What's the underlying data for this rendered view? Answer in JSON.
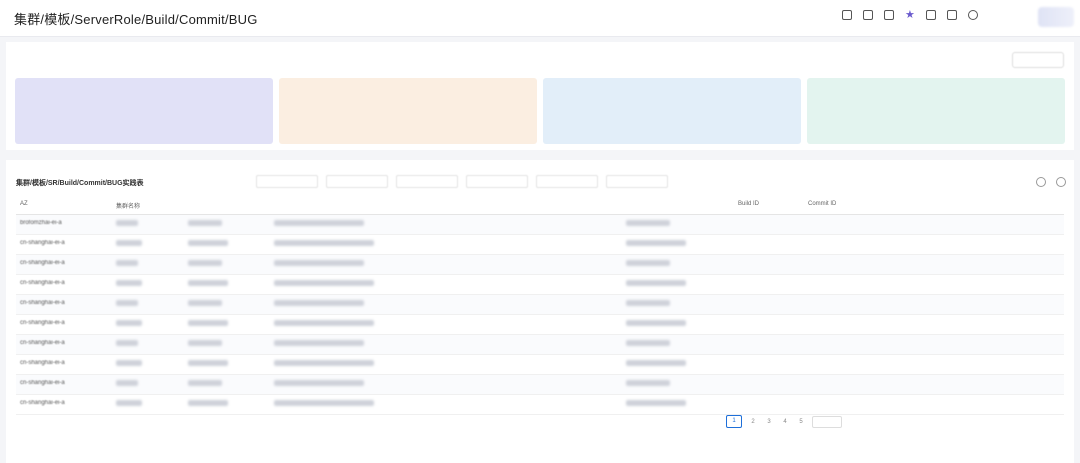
{
  "header": {
    "title": "集群/模板/ServerRole/Build/Commit/BUG",
    "icons": [
      "external-link-icon",
      "mail-icon",
      "calendar-icon",
      "star-icon",
      "home-icon",
      "edit-icon",
      "smile-icon"
    ],
    "user_name": "",
    "user_sub": ""
  },
  "top": {
    "action_label": "",
    "cards": [
      {
        "label": "",
        "value": ""
      },
      {
        "label": "",
        "value": ""
      },
      {
        "label": "",
        "value": ""
      },
      {
        "label": "",
        "value": ""
      }
    ],
    "card_colors": [
      "#e1e1f7",
      "#fbeee1",
      "#e2eef9",
      "#e3f4ef"
    ]
  },
  "table": {
    "title": "集群/模板/SR/Build/Commit/BUG实践表",
    "columns": [
      "AZ",
      "集群名称",
      "",
      "",
      "",
      "",
      "Build ID",
      "Commit ID",
      ""
    ],
    "rows": [
      {
        "az": "brofomzhai-ei-a",
        "b4": "",
        "b7": ""
      },
      {
        "az": "cn-shanghai-ei-a",
        "b4": "",
        "b7": ""
      },
      {
        "az": "cn-shanghai-ei-a",
        "b4": "",
        "b7": ""
      },
      {
        "az": "cn-shanghai-ei-a",
        "b4": "",
        "b7": ""
      },
      {
        "az": "cn-shanghai-ei-a",
        "b4": "",
        "b7": ""
      },
      {
        "az": "cn-shanghai-ei-a",
        "b4": "",
        "b7": ""
      },
      {
        "az": "cn-shanghai-ei-a",
        "b4": "",
        "b7": ""
      },
      {
        "az": "cn-shanghai-ei-a",
        "b4": "",
        "b7": ""
      },
      {
        "az": "cn-shanghai-ei-a",
        "b4": "",
        "b7": ""
      },
      {
        "az": "cn-shanghai-ei-a",
        "b4": "",
        "b7": ""
      }
    ],
    "current_page": "1",
    "pages": [
      "2",
      "3",
      "4",
      "5"
    ]
  }
}
